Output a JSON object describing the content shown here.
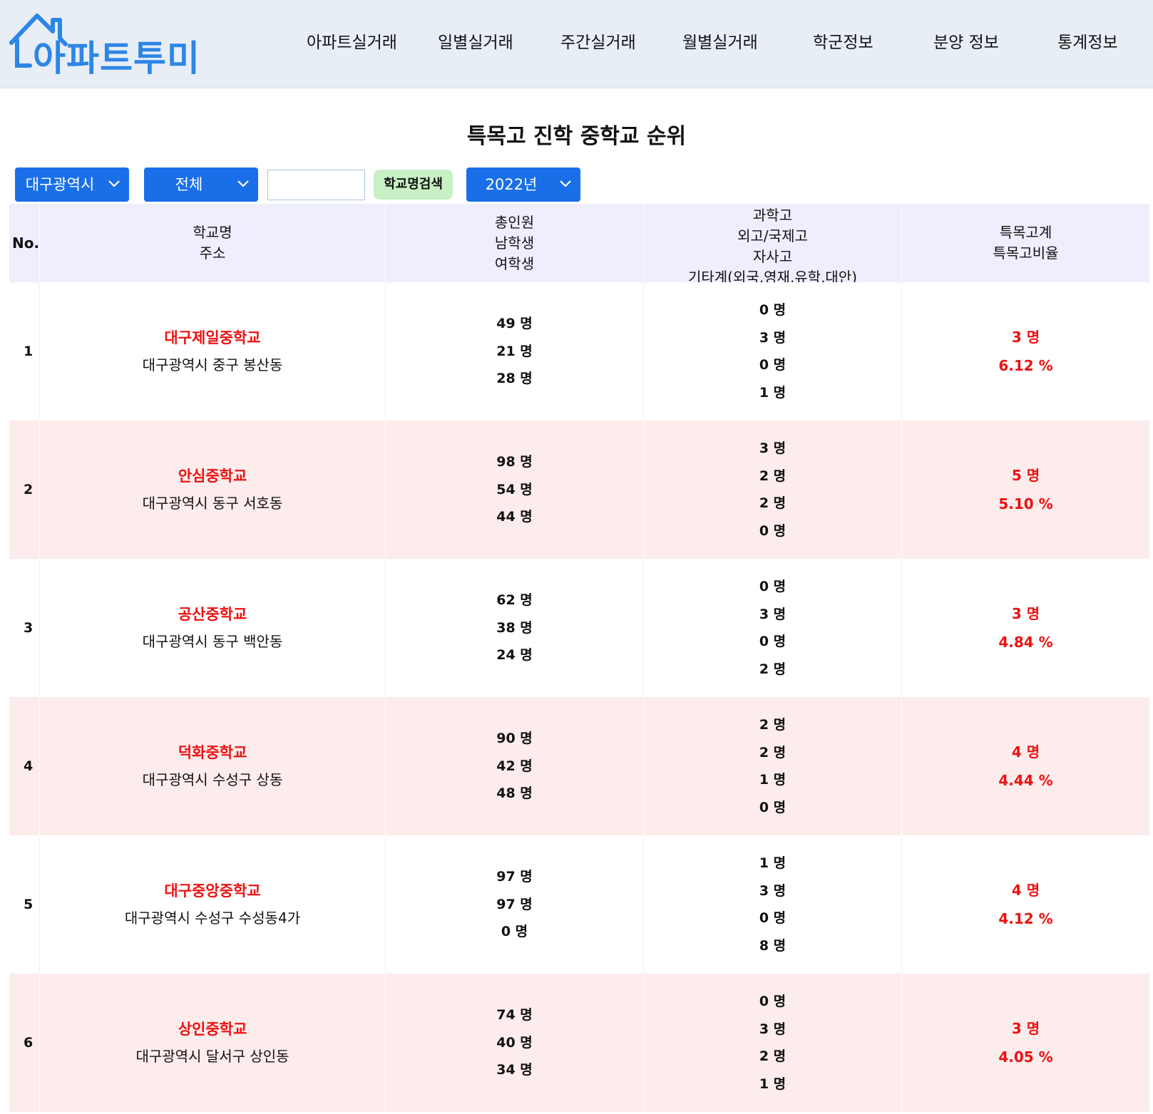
{
  "brand": {
    "logo_text": "아파트투미",
    "accent": "#2d86e6"
  },
  "nav": [
    "아파트실거래",
    "일별실거래",
    "주간실거래",
    "월별실거래",
    "학군정보",
    "분양 정보",
    "통계정보"
  ],
  "page_title": "특목고 진학 중학교 순위",
  "filters": {
    "region": "대구광역시",
    "district": "전체",
    "search_value": "",
    "search_button": "학교명검색",
    "year": "2022년"
  },
  "table": {
    "headers": {
      "no": "No.",
      "school": [
        "학교명",
        "주소"
      ],
      "students": [
        "총인원",
        "남학생",
        "여학생"
      ],
      "categories": [
        "과학고",
        "외고/국제고",
        "자사고",
        "기타계(외국,영재,유학,대안)"
      ],
      "summary": [
        "특목고계",
        "특목고비율"
      ]
    },
    "rows": [
      {
        "no": "1",
        "name": "대구제일중학교",
        "address": "대구광역시 중구 봉산동",
        "students": [
          "49 명",
          "21 명",
          "28 명"
        ],
        "categories": [
          "0 명",
          "3 명",
          "0 명",
          "1 명"
        ],
        "total": "3 명",
        "ratio": "6.12 %"
      },
      {
        "no": "2",
        "name": "안심중학교",
        "address": "대구광역시 동구 서호동",
        "students": [
          "98 명",
          "54 명",
          "44 명"
        ],
        "categories": [
          "3 명",
          "2 명",
          "2 명",
          "0 명"
        ],
        "total": "5 명",
        "ratio": "5.10 %"
      },
      {
        "no": "3",
        "name": "공산중학교",
        "address": "대구광역시 동구 백안동",
        "students": [
          "62 명",
          "38 명",
          "24 명"
        ],
        "categories": [
          "0 명",
          "3 명",
          "0 명",
          "2 명"
        ],
        "total": "3 명",
        "ratio": "4.84 %"
      },
      {
        "no": "4",
        "name": "덕화중학교",
        "address": "대구광역시 수성구 상동",
        "students": [
          "90 명",
          "42 명",
          "48 명"
        ],
        "categories": [
          "2 명",
          "2 명",
          "1 명",
          "0 명"
        ],
        "total": "4 명",
        "ratio": "4.44 %"
      },
      {
        "no": "5",
        "name": "대구중앙중학교",
        "address": "대구광역시 수성구 수성동4가",
        "students": [
          "97 명",
          "97 명",
          "0 명"
        ],
        "categories": [
          "1 명",
          "3 명",
          "0 명",
          "8 명"
        ],
        "total": "4 명",
        "ratio": "4.12 %"
      },
      {
        "no": "6",
        "name": "상인중학교",
        "address": "대구광역시 달서구 상인동",
        "students": [
          "74 명",
          "40 명",
          "34 명"
        ],
        "categories": [
          "0 명",
          "3 명",
          "2 명",
          "1 명"
        ],
        "total": "3 명",
        "ratio": "4.05 %"
      }
    ]
  },
  "colors": {
    "select_bg": "#1a6fe8",
    "search_btn_bg": "#c8f0c4",
    "highlight_text": "#ee1111",
    "alt_row_bg": "#fdecec",
    "header_bg": "#eeeefc"
  }
}
